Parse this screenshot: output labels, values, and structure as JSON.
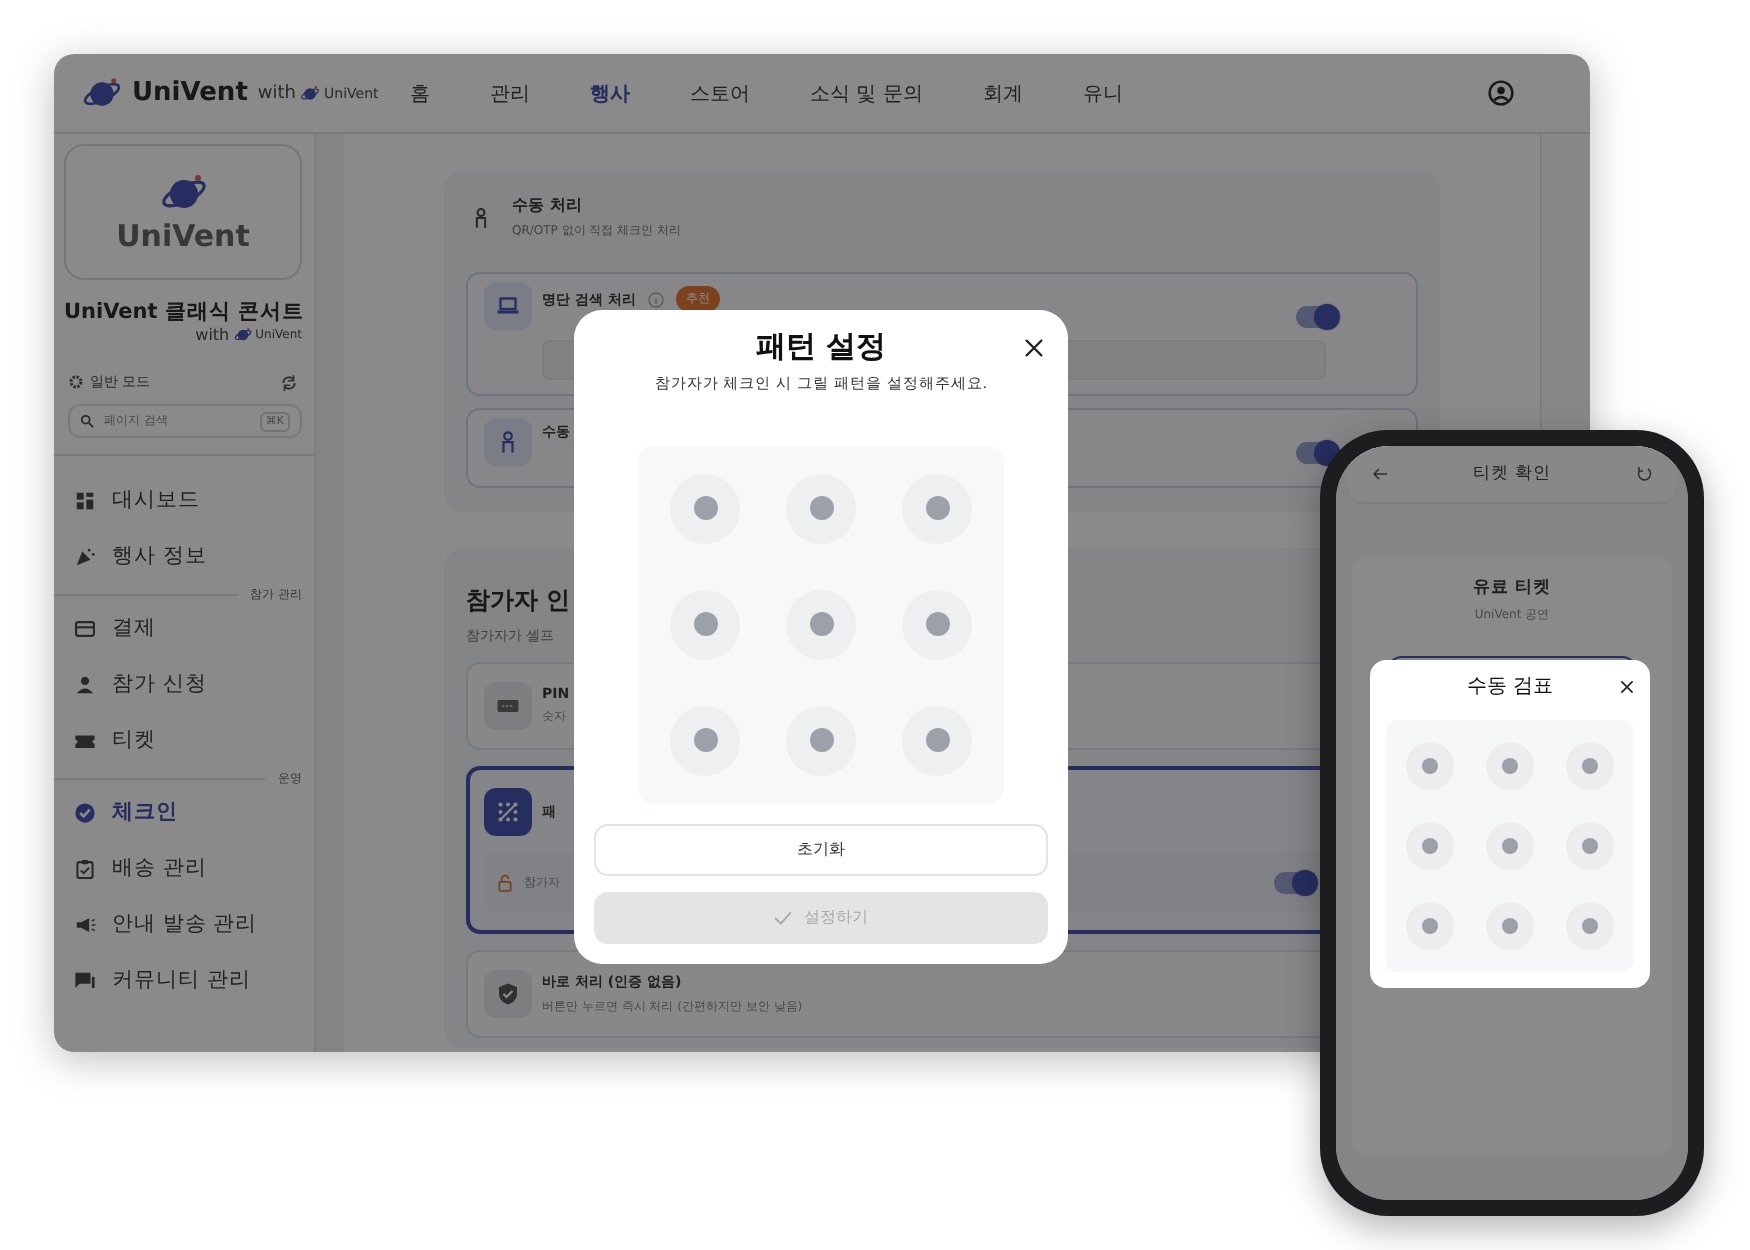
{
  "nav": {
    "logo": "UniVent",
    "with": "with",
    "with_brand": "UniVent",
    "items": [
      {
        "label": "홈",
        "selected": false
      },
      {
        "label": "관리",
        "selected": false
      },
      {
        "label": "행사",
        "selected": true
      },
      {
        "label": "스토어",
        "selected": false
      },
      {
        "label": "소식 및 문의",
        "selected": false
      },
      {
        "label": "회계",
        "selected": false
      },
      {
        "label": "유니",
        "selected": false
      }
    ]
  },
  "sidebar": {
    "logo": "UniVent",
    "event_title": "UniVent 클래식 콘서트",
    "with": "with",
    "with_brand": "UniVent",
    "mode": "일반 모드",
    "search": {
      "placeholder": "페이지 검색",
      "shortcut": "⌘K"
    },
    "items": [
      {
        "kind": "item",
        "label": "대시보드",
        "selected": false
      },
      {
        "kind": "item",
        "label": "행사 정보",
        "selected": false
      },
      {
        "kind": "section",
        "label": "참가 관리"
      },
      {
        "kind": "item",
        "label": "결제",
        "selected": false
      },
      {
        "kind": "item",
        "label": "참가 신청",
        "selected": false
      },
      {
        "kind": "item",
        "label": "티켓",
        "selected": false
      },
      {
        "kind": "section",
        "label": "운영"
      },
      {
        "kind": "item",
        "label": "체크인",
        "selected": true
      },
      {
        "kind": "item",
        "label": "배송 관리",
        "selected": false
      },
      {
        "kind": "item",
        "label": "안내 발송 관리",
        "selected": false
      },
      {
        "kind": "item",
        "label": "커뮤니티 관리",
        "selected": false
      }
    ]
  },
  "main": {
    "manual_card": {
      "title": "수동 처리",
      "subtitle": "QR/OTP 없이 직접 체크인 처리",
      "options": [
        {
          "title": "명단 검색 처리",
          "badge": "추천",
          "on": true
        },
        {
          "title": "수동",
          "on": true
        }
      ]
    },
    "auth_card": {
      "title": "참가자 인",
      "subtitle": "참가자가 셀프",
      "methods": [
        {
          "kind": "pin",
          "title": "PIN",
          "description": "숫자",
          "selected": false
        },
        {
          "kind": "pattern",
          "title": "패",
          "note": "참가자",
          "on": true,
          "selected": true
        },
        {
          "kind": "instant",
          "title": "바로 처리 (인증 없음)",
          "description": "버튼만 누르면 즉시 처리 (간편하지만 보안 낮음)",
          "selected": false
        }
      ]
    }
  },
  "modal": {
    "title": "패턴 설정",
    "subtitle": "참가자가 체크인 시 그릴 패턴을 설정해주세요.",
    "buttons": [
      {
        "kind": "secondary",
        "label": "초기화",
        "disabled": false
      },
      {
        "kind": "primary",
        "label": "설정하기",
        "disabled": true
      }
    ]
  },
  "phone": {
    "title": "티켓 확인",
    "ticket": "유료 티켓",
    "event": "UniVent 공연",
    "modal": {
      "title": "수동 검표"
    }
  }
}
